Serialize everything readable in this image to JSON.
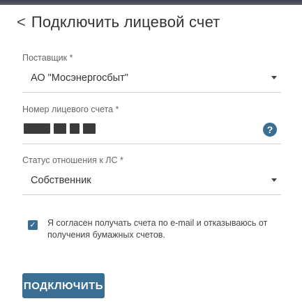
{
  "header": {
    "back_glyph": "<",
    "title": "Подключить лицевой счет"
  },
  "supplier": {
    "label": "Поставщик *",
    "value": "АО \"Мосэнергосбыт\"",
    "icon": "chevron-down-icon"
  },
  "account": {
    "label": "Номер лицевого счета *",
    "masked": true,
    "help_glyph": "?",
    "icon": "help-icon"
  },
  "relation": {
    "label": "Статус отношения к ЛС *",
    "value": "Собственник",
    "icon": "chevron-down-icon"
  },
  "consent": {
    "checked": true,
    "check_glyph": "✓",
    "text": "Я согласен получать счета по e-mail и отказываюсь от получения бумажных счетов."
  },
  "actions": {
    "connect_label": "ПОДКЛЮЧИТЬ"
  },
  "colors": {
    "accent": "#3b6e93",
    "top_strip": "#4a4c5a",
    "text": "#333333",
    "label": "#666666",
    "divider": "#cfcfcf"
  }
}
